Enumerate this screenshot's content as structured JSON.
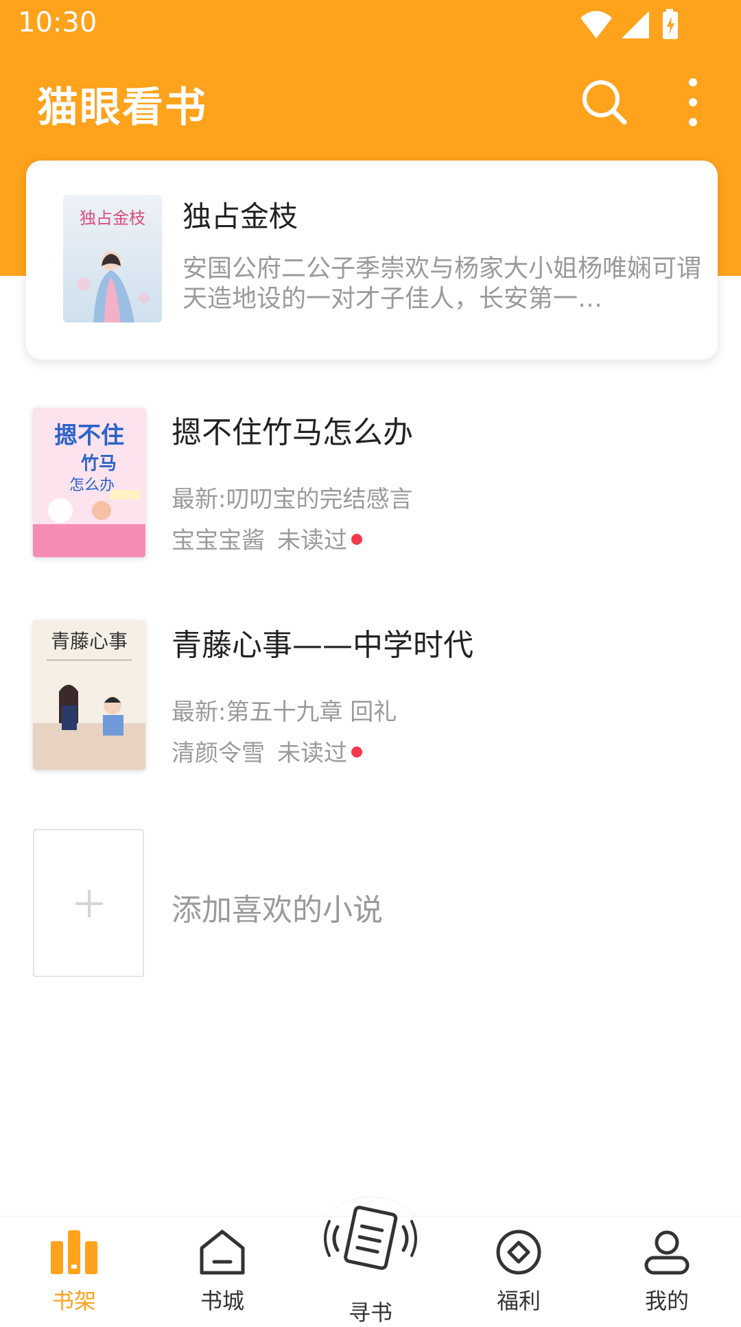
{
  "status_bar": {
    "time": "10:30"
  },
  "header": {
    "app_title": "猫眼看书",
    "search_icon": "search-icon",
    "more_icon": "more-vertical-icon"
  },
  "featured": {
    "title": "独占金枝",
    "description": "安国公府二公子季崇欢与杨家大小姐杨唯娴可谓天造地设的一对才子佳人，长安第一…",
    "cover_text": "独占金枝"
  },
  "books": [
    {
      "title": "摁不住竹马怎么办",
      "latest": "最新:叨叨宝的完结感言",
      "author": "宝宝宝酱",
      "status": "未读过",
      "cover_text": "摁不住竹马怎么办"
    },
    {
      "title": "青藤心事——中学时代",
      "latest": "最新:第五十九章 回礼",
      "author": "清颜令雪",
      "status": "未读过",
      "cover_text": "青藤心事"
    }
  ],
  "add_book": {
    "label": "添加喜欢的小说"
  },
  "tabs": [
    {
      "label": "书架",
      "icon": "bookshelf-icon",
      "active": true
    },
    {
      "label": "书城",
      "icon": "bookstore-icon",
      "active": false
    },
    {
      "label": "寻书",
      "icon": "find-book-icon",
      "active": false
    },
    {
      "label": "福利",
      "icon": "bonus-icon",
      "active": false
    },
    {
      "label": "我的",
      "icon": "profile-icon",
      "active": false
    }
  ],
  "colors": {
    "brand": "#FFA21C",
    "unread_dot": "#F5394A",
    "muted_text": "#9a9a9a"
  }
}
